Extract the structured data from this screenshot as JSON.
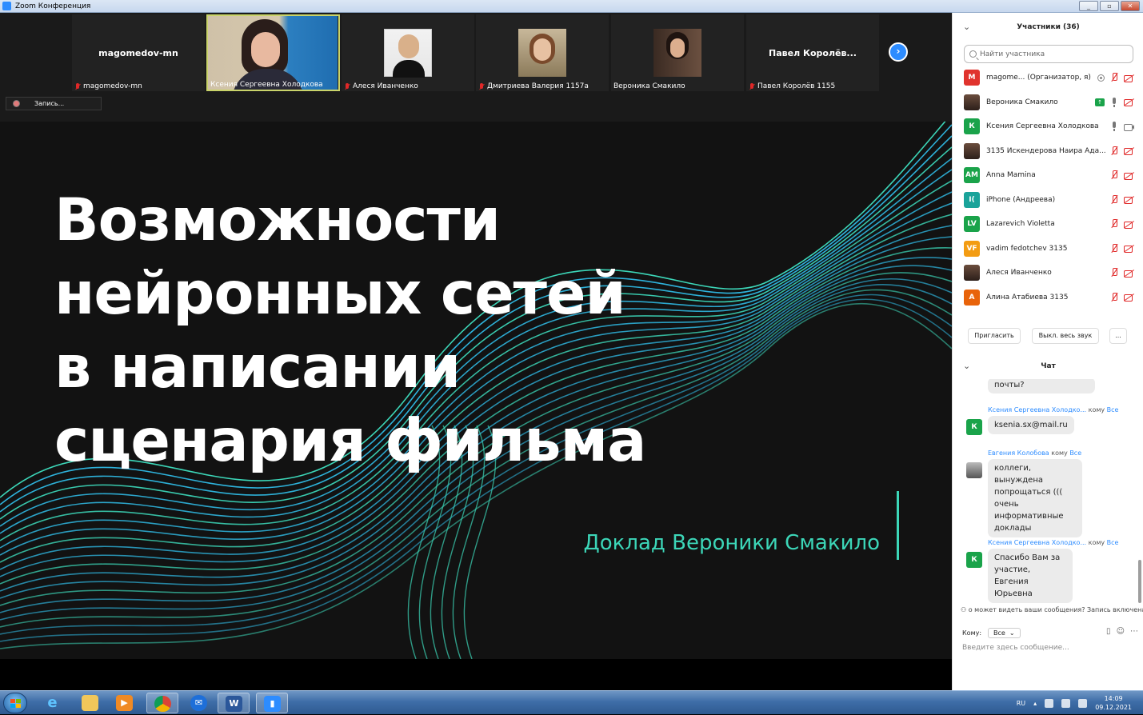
{
  "window": {
    "title": "Zoom Конференция"
  },
  "video_strip": {
    "tiles": [
      {
        "name": "magomedov-mn",
        "label": "magomedov-mn",
        "muted": true
      },
      {
        "name": "",
        "label": "Ксения Сергеевна Холодкова",
        "muted": false
      },
      {
        "name": "",
        "label": "Алеся Иванченко",
        "muted": true
      },
      {
        "name": "",
        "label": "Дмитриева Валерия 1157а",
        "muted": true
      },
      {
        "name": "",
        "label": "Вероника Смакило",
        "muted": false
      },
      {
        "name": "Павел Королёв...",
        "label": "Павел Королёв 1155",
        "muted": true
      }
    ],
    "next_icon": "chevron-right-icon",
    "recording_label": "Запись..."
  },
  "slide": {
    "title_lines": [
      "Возможности",
      "нейронных сетей",
      "в написании",
      "сценария фильма"
    ],
    "subtitle": "Доклад Вероники Смакило",
    "accent_color": "#3cd6b8",
    "line_color": "#2fb7e0"
  },
  "participants": {
    "header": "Участники (36)",
    "search_placeholder": "Найти участника",
    "list": [
      {
        "initials": "M",
        "color": "#e0332d",
        "name": "magome...  (Организатор, я)",
        "mic": "off",
        "cam": "off",
        "rec": true
      },
      {
        "initials": "",
        "color": "photo",
        "name": "Вероника Смакило",
        "mic": "on",
        "cam": "off",
        "share": true
      },
      {
        "initials": "К",
        "color": "#1aa34a",
        "name": "Ксения Сергеевна Холодкова",
        "mic": "on",
        "cam": "on"
      },
      {
        "initials": "",
        "color": "photo",
        "name": "3135 Искендерова Наира Ада...",
        "mic": "off",
        "cam": "off"
      },
      {
        "initials": "AM",
        "color": "#1aa34a",
        "name": "Anna Mamina",
        "mic": "off",
        "cam": "off"
      },
      {
        "initials": "I(",
        "color": "#1aa39a",
        "name": "iPhone (Андреева)",
        "mic": "off",
        "cam": "off"
      },
      {
        "initials": "LV",
        "color": "#1aa34a",
        "name": "Lazarevich Violetta",
        "mic": "off",
        "cam": "off"
      },
      {
        "initials": "VF",
        "color": "#f39c12",
        "name": "vadim fedotchev 3135",
        "mic": "off",
        "cam": "off"
      },
      {
        "initials": "",
        "color": "photo",
        "name": "Алеся Иванченко",
        "mic": "off",
        "cam": "off"
      },
      {
        "initials": "А",
        "color": "#e8630a",
        "name": "Алина Атабиева 3135",
        "mic": "off",
        "cam": "off"
      }
    ],
    "invite_label": "Пригласить",
    "mute_all_label": "Выкл. весь звук",
    "more_label": "..."
  },
  "chat": {
    "header": "Чат",
    "messages": [
      {
        "sender": "",
        "to": "",
        "text": "почты?",
        "avatar": ""
      },
      {
        "sender": "Ксения Сергеевна Холодко...",
        "to_prefix": "кому",
        "to": "Все",
        "text": "ksenia.sx@mail.ru",
        "avatar": "К"
      },
      {
        "sender": "Евгения Колобова",
        "to_prefix": "кому",
        "to": "Все",
        "text": "коллеги, вынуждена попрощаться ((( очень информативные доклады",
        "avatar": ""
      },
      {
        "sender": "Ксения Сергеевна Холодко...",
        "to_prefix": "кому",
        "to": "Все",
        "text": "Спасибо Вам за участие, Евгения Юрьевна",
        "avatar": "К"
      }
    ],
    "notice": "о может видеть ваши сообщения? Запись включена",
    "to_label": "Кому:",
    "to_value": "Все",
    "input_placeholder": "Введите здесь сообщение..."
  },
  "taskbar": {
    "apps": [
      "ie-icon",
      "explorer-icon",
      "media-player-icon",
      "chrome-icon",
      "thunderbird-icon",
      "word-icon",
      "zoom-icon"
    ],
    "lang": "RU",
    "time": "14:09",
    "date": "09.12.2021"
  }
}
